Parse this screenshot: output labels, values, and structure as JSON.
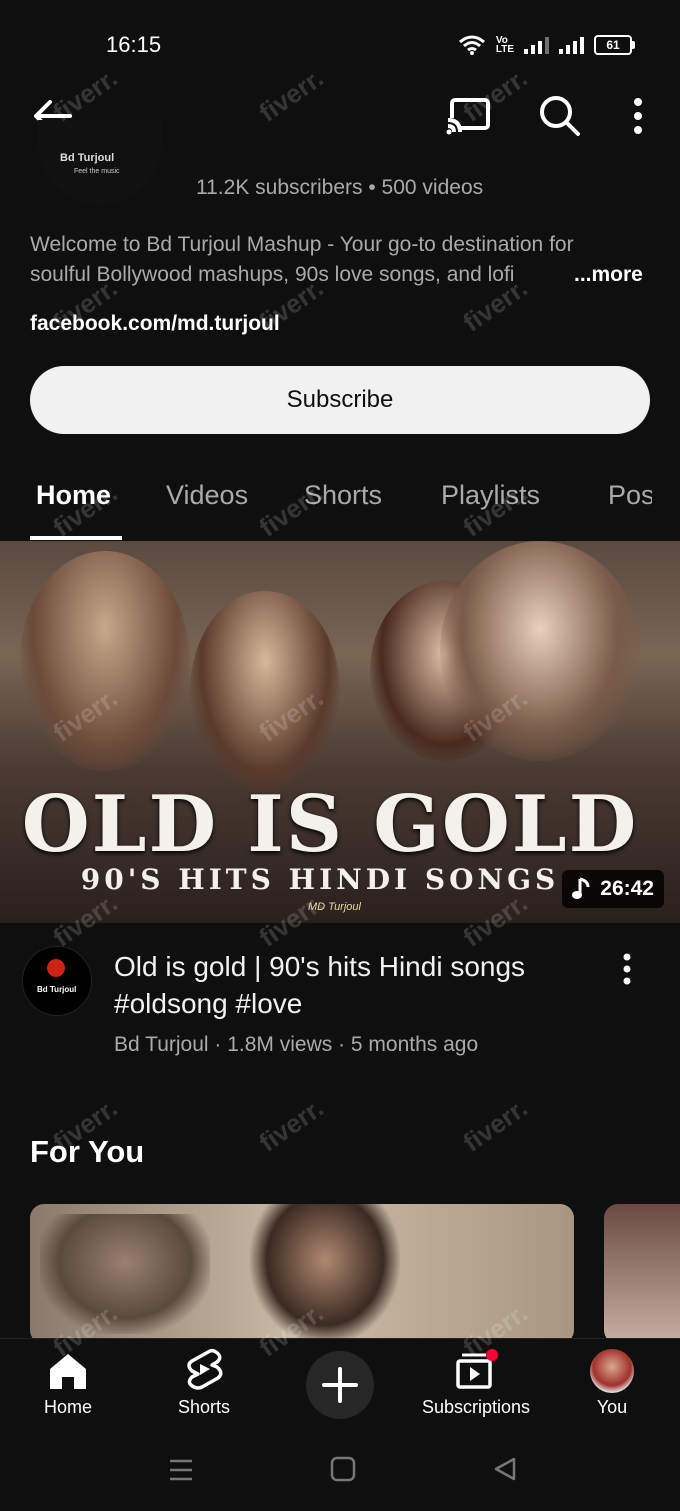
{
  "status_bar": {
    "time": "16:15",
    "volte": "Vo\nLTE",
    "battery": "61"
  },
  "channel": {
    "stats": "11.2K subscribers • 500 videos",
    "avatar_title": "Bd Turjoul",
    "avatar_sub": "Feel the music",
    "description_line1": "Welcome to Bd Turjoul Mashup - Your go-to destination for",
    "description_line2": "soulful Bollywood mashups, 90s love songs, and lofi",
    "more_label": "...more",
    "link": "facebook.com/md.turjoul",
    "subscribe_label": "Subscribe"
  },
  "tabs": [
    {
      "label": "Home"
    },
    {
      "label": "Videos"
    },
    {
      "label": "Shorts"
    },
    {
      "label": "Playlists"
    },
    {
      "label": "Posts"
    }
  ],
  "featured": {
    "thumb_title": "OLD IS GOLD",
    "thumb_subtitle": "90'S HITS HINDI SONGS",
    "thumb_signature": "MD Turjoul",
    "duration": "26:42",
    "title": "Old is gold | 90's hits Hindi songs #oldsong #love",
    "meta": "Bd Turjoul · 1.8M views · 5 months ago",
    "avatar_label": "Bd Turjoul"
  },
  "section": {
    "for_you": "For You"
  },
  "bottom_nav": [
    {
      "label": "Home",
      "icon": "home-icon"
    },
    {
      "label": "Shorts",
      "icon": "shorts-icon"
    },
    {
      "label": "",
      "icon": "plus-icon"
    },
    {
      "label": "Subscriptions",
      "icon": "subscriptions-icon"
    },
    {
      "label": "You",
      "icon": "avatar"
    }
  ],
  "watermark": "fiverr.",
  "colors": {
    "background": "#0f0f0f",
    "text": "#f1f1f1",
    "secondary": "#aaaaaa",
    "notification": "#ff0033"
  }
}
